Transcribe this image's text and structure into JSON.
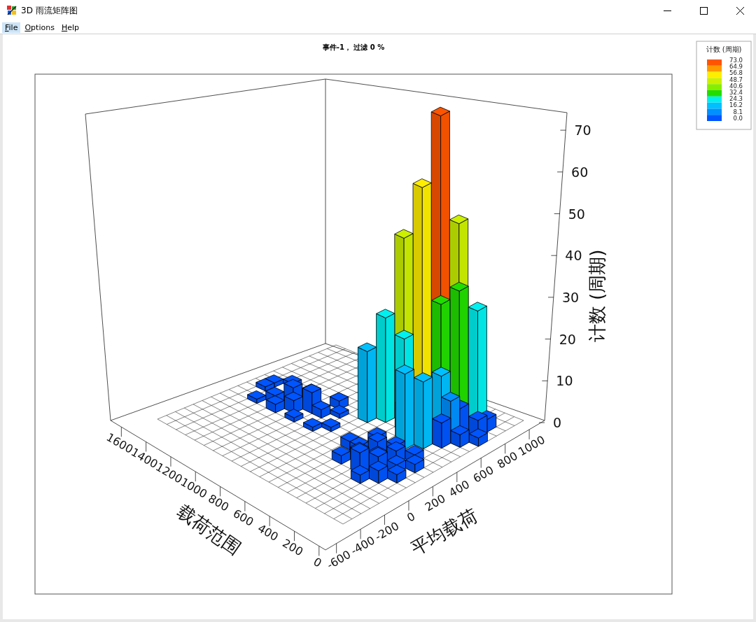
{
  "window": {
    "title": "3D 雨流矩阵图"
  },
  "menu": [
    {
      "label": "File",
      "selected": true
    },
    {
      "label": "Options",
      "selected": false
    },
    {
      "label": "Help",
      "selected": false
    }
  ],
  "chart": {
    "title": "事件-1， 过滤 0 %",
    "z_axis": {
      "title": "计数 (周期)",
      "ticks": [
        "70",
        "60",
        "50",
        "40",
        "30",
        "20",
        "10",
        "0"
      ]
    },
    "x_axis": {
      "title": "载荷范围",
      "ticks": [
        "0",
        "200",
        "400",
        "600",
        "800",
        "1000",
        "1200",
        "1400",
        "1600"
      ]
    },
    "y_axis": {
      "title": "平均载荷",
      "ticks": [
        "-600",
        "-400",
        "-200",
        "0",
        "200",
        "400",
        "600",
        "800",
        "1000"
      ]
    }
  },
  "legend": {
    "title": "计数 (周期)",
    "items": [
      {
        "label": "73.0",
        "color": "#ff5500"
      },
      {
        "label": "64.9",
        "color": "#ff9900"
      },
      {
        "label": "56.8",
        "color": "#ffee00"
      },
      {
        "label": "48.7",
        "color": "#ccf000"
      },
      {
        "label": "40.6",
        "color": "#88ee00"
      },
      {
        "label": "32.4",
        "color": "#22dd00"
      },
      {
        "label": "24.3",
        "color": "#00f0f0"
      },
      {
        "label": "16.2",
        "color": "#00c0ff"
      },
      {
        "label": "8.1",
        "color": "#0090ff"
      },
      {
        "label": "0.0",
        "color": "#0055ff"
      }
    ]
  }
}
